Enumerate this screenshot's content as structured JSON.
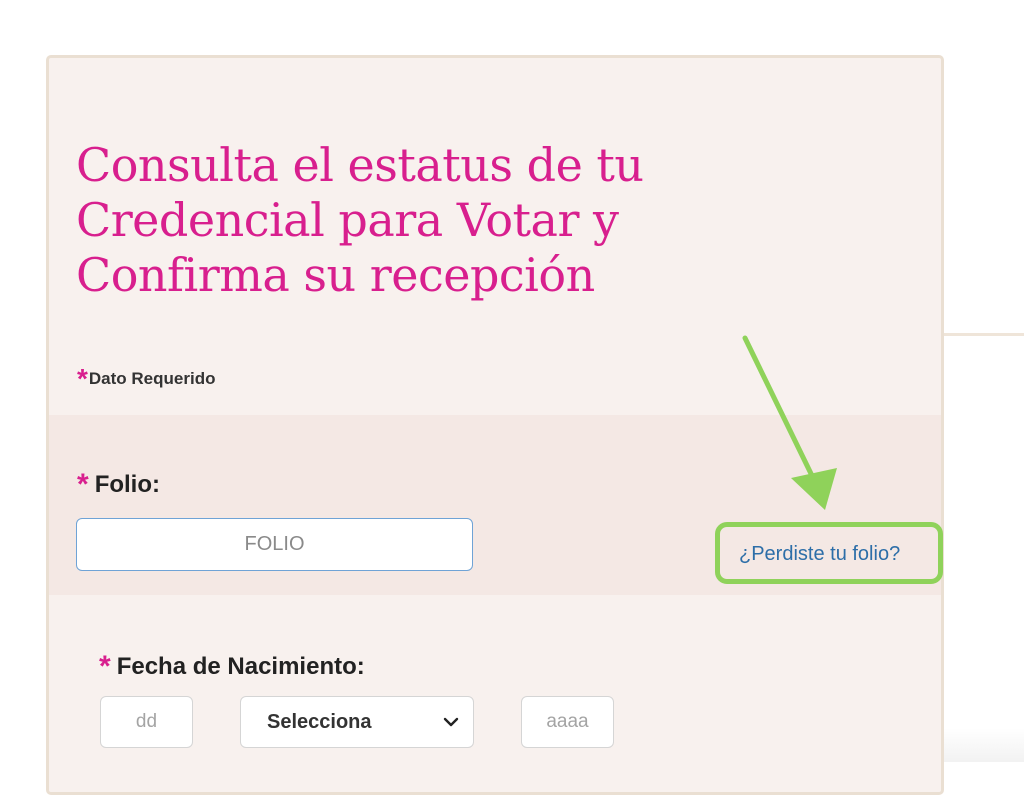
{
  "form": {
    "title_lines": [
      "Consulta el estatus de tu",
      "Credencial para Votar y",
      "Confirma su recepción"
    ],
    "required_star": "*",
    "required_note": "Dato Requerido",
    "folio": {
      "label": "Folio:",
      "placeholder": "FOLIO",
      "lost_link": "¿Perdiste tu folio?"
    },
    "birth_date": {
      "label": "Fecha de Nacimiento:",
      "day_placeholder": "dd",
      "month_value": "Selecciona",
      "year_placeholder": "aaaa"
    }
  },
  "colors": {
    "accent": "#d81f8e",
    "link": "#2d6ea8",
    "highlight": "#8fd25a",
    "card_bg": "#f8f1ee",
    "band_bg": "#f4e8e4"
  }
}
